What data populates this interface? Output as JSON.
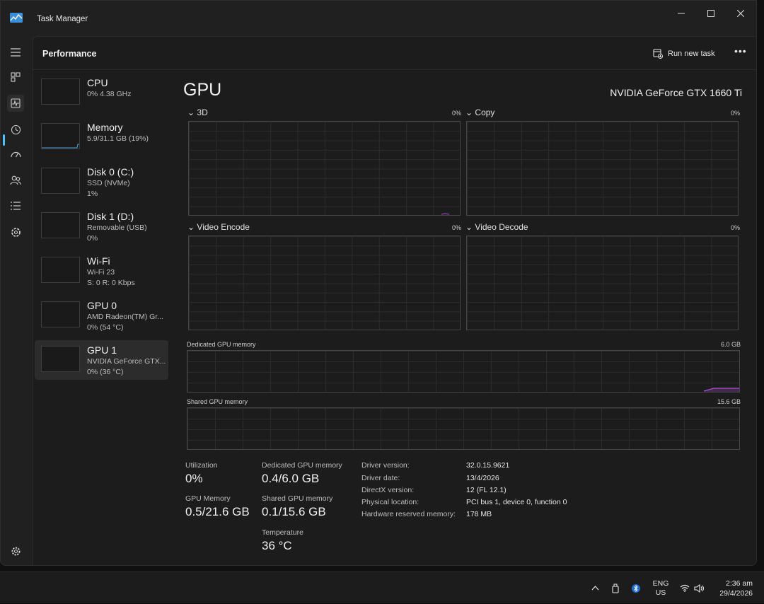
{
  "window": {
    "title": "Task Manager"
  },
  "header": {
    "page_title": "Performance",
    "run_new_task": "Run new task"
  },
  "devices": [
    {
      "name": "CPU",
      "sub1": "0% 4.38 GHz",
      "sub2": ""
    },
    {
      "name": "Memory",
      "sub1": "5.9/31.1 GB (19%)",
      "sub2": ""
    },
    {
      "name": "Disk 0 (C:)",
      "sub1": "SSD (NVMe)",
      "sub2": "1%"
    },
    {
      "name": "Disk 1 (D:)",
      "sub1": "Removable (USB)",
      "sub2": "0%"
    },
    {
      "name": "Wi-Fi",
      "sub1": "Wi-Fi 23",
      "sub2": "S: 0 R: 0 Kbps"
    },
    {
      "name": "GPU 0",
      "sub1": "AMD Radeon(TM) Gr...",
      "sub2": "0% (54 °C)"
    },
    {
      "name": "GPU 1",
      "sub1": "NVIDIA GeForce GTX...",
      "sub2": "0% (36 °C)"
    }
  ],
  "main": {
    "title": "GPU",
    "model": "NVIDIA GeForce GTX 1660 Ti",
    "graphs": [
      {
        "label": "3D",
        "pct": "0%"
      },
      {
        "label": "Copy",
        "pct": "0%"
      },
      {
        "label": "Video Encode",
        "pct": "0%"
      },
      {
        "label": "Video Decode",
        "pct": "0%"
      }
    ],
    "dedicated_label": "Dedicated GPU memory",
    "dedicated_max": "6.0 GB",
    "shared_label": "Shared GPU memory",
    "shared_max": "15.6 GB",
    "stats": {
      "utilization_label": "Utilization",
      "utilization": "0%",
      "gpu_memory_label": "GPU Memory",
      "gpu_memory": "0.5/21.6 GB",
      "dedicated_label": "Dedicated GPU memory",
      "dedicated": "0.4/6.0 GB",
      "shared_label": "Shared GPU memory",
      "shared": "0.1/15.6 GB",
      "temperature_label": "Temperature",
      "temperature": "36 °C"
    },
    "info": [
      {
        "key": "Driver version:",
        "value": "32.0.15.9621"
      },
      {
        "key": "Driver date:",
        "value": "13/4/2026"
      },
      {
        "key": "DirectX version:",
        "value": "12 (FL 12.1)"
      },
      {
        "key": "Physical location:",
        "value": "PCI bus 1, device 0, function 0"
      },
      {
        "key": "Hardware reserved memory:",
        "value": "178 MB"
      }
    ]
  },
  "taskbar": {
    "lang1": "ENG",
    "lang2": "US",
    "time": "2:36 am",
    "date": "29/4/2026"
  },
  "colors": {
    "accent": "#4cc2ff",
    "gpu_line": "#b04fd6"
  }
}
